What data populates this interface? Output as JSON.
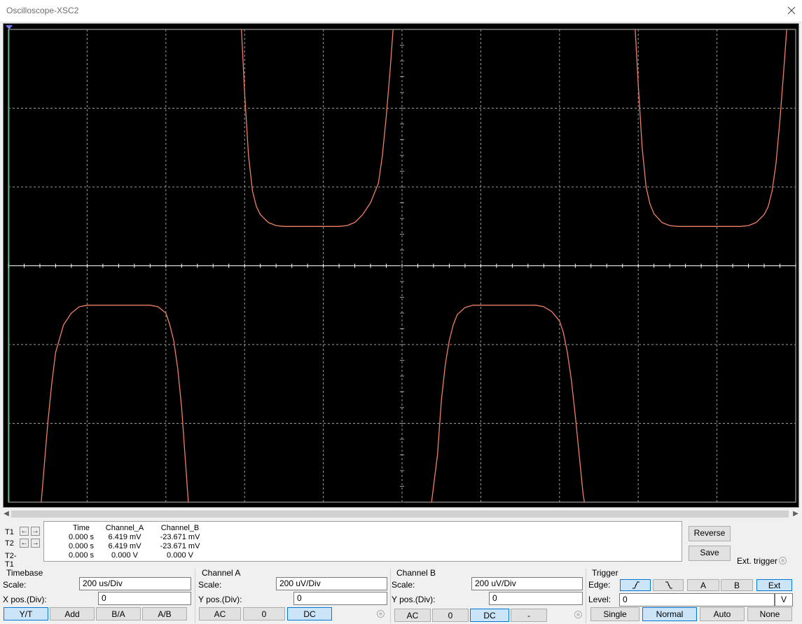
{
  "window": {
    "title": "Oscilloscope-XSC2"
  },
  "colors": {
    "trace": "#f07f66",
    "grid": "#9a9a9a",
    "axis": "#ffffff",
    "background": "#000000",
    "active_button": "#cce4f7"
  },
  "cursors": {
    "t1": "T1",
    "t2": "T2",
    "t2t1": "T2-T1",
    "headers": [
      "Time",
      "Channel_A",
      "Channel_B"
    ],
    "rows": [
      [
        "0.000 s",
        "6.419 mV",
        "-23.671 mV"
      ],
      [
        "0.000 s",
        "6.419 mV",
        "-23.671 mV"
      ],
      [
        "0.000 s",
        "0.000 V",
        "0.000 V"
      ]
    ]
  },
  "side_buttons": {
    "reverse": "Reverse",
    "save": "Save",
    "ext_trigger": "Ext. trigger"
  },
  "timebase": {
    "title": "Timebase",
    "scale_label": "Scale:",
    "scale_value": "200 us/Div",
    "xpos_label": "X pos.(Div):",
    "xpos_value": "0",
    "modes": [
      "Y/T",
      "Add",
      "B/A",
      "A/B"
    ],
    "active_mode": "Y/T"
  },
  "channel_a": {
    "title": "Channel A",
    "scale_label": "Scale:",
    "scale_value": "200 uV/Div",
    "ypos_label": "Y pos.(Div):",
    "ypos_value": "0",
    "coupling": [
      "AC",
      "0",
      "DC"
    ],
    "active_coupling": "DC"
  },
  "channel_b": {
    "title": "Channel B",
    "scale_label": "Scale:",
    "scale_value": "200 uV/Div",
    "ypos_label": "Y pos.(Div):",
    "ypos_value": "0",
    "coupling": [
      "AC",
      "0",
      "DC",
      "-"
    ],
    "active_coupling": "DC"
  },
  "trigger": {
    "title": "Trigger",
    "edge_label": "Edge:",
    "edge_buttons": [
      "falling-edge-icon",
      "rising-edge-icon"
    ],
    "sources": [
      "A",
      "B",
      "Ext"
    ],
    "active_source": "Ext",
    "level_label": "Level:",
    "level_value": "0",
    "level_unit": "V",
    "modes": [
      "Single",
      "Normal",
      "Auto",
      "None"
    ],
    "active_mode": "Normal"
  },
  "chart_data": {
    "type": "line",
    "title": "",
    "xlabel": "",
    "ylabel": "",
    "divisions": {
      "x": 10,
      "y": 6
    },
    "time_per_div_us": 200,
    "volts_per_div_uV": 200,
    "xlim_div": [
      0,
      10
    ],
    "ylim_div": [
      -3,
      3
    ],
    "grid": true,
    "series": [
      {
        "x_div": [
          0.0,
          0.4,
          0.45,
          0.5,
          0.55,
          0.6,
          0.7,
          0.8,
          0.9,
          1.0,
          1.1,
          1.2,
          1.3,
          1.4,
          1.5,
          1.6,
          1.7,
          1.8,
          1.9,
          2.0,
          2.05,
          2.1,
          2.15,
          2.2,
          2.25,
          2.3,
          2.7,
          2.95,
          3.0,
          3.05,
          3.1,
          3.15,
          3.2,
          3.3,
          3.4,
          3.5,
          3.6,
          3.7,
          3.8,
          3.9,
          4.0,
          4.1,
          4.2,
          4.3,
          4.4,
          4.5,
          4.6,
          4.7,
          4.75,
          4.8,
          4.85,
          4.9,
          4.95,
          5.35,
          5.45,
          5.5,
          5.55,
          5.6,
          5.65,
          5.7,
          5.8,
          5.9,
          6.0,
          6.1,
          6.2,
          6.3,
          6.4,
          6.5,
          6.6,
          6.7,
          6.8,
          6.9,
          7.0,
          7.05,
          7.1,
          7.15,
          7.2,
          7.25,
          7.3,
          7.35,
          7.8,
          7.95,
          8.0,
          8.05,
          8.1,
          8.15,
          8.2,
          8.3,
          8.4,
          8.5,
          8.6,
          8.7,
          8.8,
          8.9,
          9.0,
          9.1,
          9.2,
          9.3,
          9.4,
          9.5,
          9.6,
          9.65,
          9.7,
          9.75,
          9.8,
          9.85,
          9.9
        ],
        "y_div": [
          -3.2,
          -3.2,
          -2.6,
          -2.0,
          -1.5,
          -1.1,
          -0.75,
          -0.6,
          -0.52,
          -0.5,
          -0.5,
          -0.5,
          -0.5,
          -0.5,
          -0.5,
          -0.5,
          -0.5,
          -0.5,
          -0.52,
          -0.6,
          -0.75,
          -0.95,
          -1.3,
          -1.8,
          -2.5,
          -3.2,
          -3.2,
          3.2,
          2.2,
          1.4,
          0.95,
          0.75,
          0.65,
          0.55,
          0.51,
          0.5,
          0.5,
          0.5,
          0.5,
          0.5,
          0.5,
          0.5,
          0.5,
          0.51,
          0.55,
          0.65,
          0.8,
          1.05,
          1.4,
          1.9,
          2.5,
          3.2,
          3.2,
          -3.2,
          -2.4,
          -1.7,
          -1.25,
          -0.95,
          -0.75,
          -0.62,
          -0.53,
          -0.5,
          -0.5,
          -0.5,
          -0.5,
          -0.5,
          -0.5,
          -0.5,
          -0.5,
          -0.5,
          -0.52,
          -0.58,
          -0.7,
          -0.85,
          -1.1,
          -1.45,
          -1.9,
          -2.4,
          -2.9,
          -3.2,
          -3.2,
          3.2,
          2.3,
          1.5,
          1.0,
          0.78,
          0.66,
          0.55,
          0.51,
          0.5,
          0.5,
          0.5,
          0.5,
          0.5,
          0.5,
          0.5,
          0.5,
          0.5,
          0.51,
          0.55,
          0.65,
          0.75,
          0.95,
          1.3,
          1.85,
          2.5,
          3.2
        ]
      }
    ]
  }
}
